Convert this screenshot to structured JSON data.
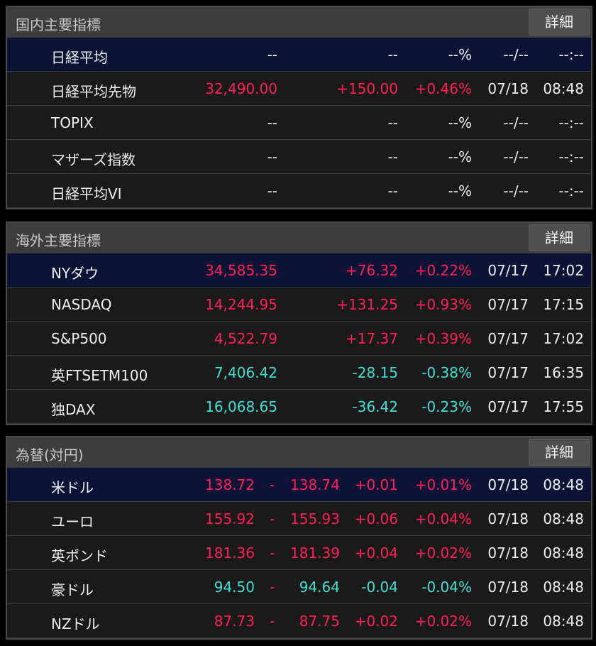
{
  "domestic": {
    "title": "国内主要指標",
    "detail_label": "詳細",
    "rows": [
      {
        "name": "日経平均",
        "price": "--",
        "change": "--",
        "pct": "--%",
        "date": "--/--",
        "time": "--:--",
        "dir": "neutral"
      },
      {
        "name": "日経平均先物",
        "price": "32,490.00",
        "change": "+150.00",
        "pct": "+0.46%",
        "date": "07/18",
        "time": "08:48",
        "dir": "up"
      },
      {
        "name": "TOPIX",
        "price": "--",
        "change": "--",
        "pct": "--%",
        "date": "--/--",
        "time": "--:--",
        "dir": "neutral"
      },
      {
        "name": "マザーズ指数",
        "price": "--",
        "change": "--",
        "pct": "--%",
        "date": "--/--",
        "time": "--:--",
        "dir": "neutral"
      },
      {
        "name": "日経平均VI",
        "price": "--",
        "change": "--",
        "pct": "--%",
        "date": "--/--",
        "time": "--:--",
        "dir": "neutral"
      }
    ]
  },
  "overseas": {
    "title": "海外主要指標",
    "detail_label": "詳細",
    "rows": [
      {
        "name": "NYダウ",
        "price": "34,585.35",
        "change": "+76.32",
        "pct": "+0.22%",
        "date": "07/17",
        "time": "17:02",
        "dir": "up"
      },
      {
        "name": "NASDAQ",
        "price": "14,244.95",
        "change": "+131.25",
        "pct": "+0.93%",
        "date": "07/17",
        "time": "17:15",
        "dir": "up"
      },
      {
        "name": "S&P500",
        "price": "4,522.79",
        "change": "+17.37",
        "pct": "+0.39%",
        "date": "07/17",
        "time": "17:02",
        "dir": "up"
      },
      {
        "name": "英FTSETM100",
        "price": "7,406.42",
        "change": "-28.15",
        "pct": "-0.38%",
        "date": "07/17",
        "time": "16:35",
        "dir": "down"
      },
      {
        "name": "独DAX",
        "price": "16,068.65",
        "change": "-36.42",
        "pct": "-0.23%",
        "date": "07/17",
        "time": "17:55",
        "dir": "down"
      }
    ]
  },
  "fx": {
    "title": "為替(対円)",
    "detail_label": "詳細",
    "rows": [
      {
        "name": "米ドル",
        "bid": "138.72",
        "dash": "-",
        "ask": "138.74",
        "change": "+0.01",
        "pct": "+0.01%",
        "date": "07/18",
        "time": "08:48",
        "dir": "up"
      },
      {
        "name": "ユーロ",
        "bid": "155.92",
        "dash": "-",
        "ask": "155.93",
        "change": "+0.06",
        "pct": "+0.04%",
        "date": "07/18",
        "time": "08:48",
        "dir": "up"
      },
      {
        "name": "英ポンド",
        "bid": "181.36",
        "dash": "-",
        "ask": "181.39",
        "change": "+0.04",
        "pct": "+0.02%",
        "date": "07/18",
        "time": "08:48",
        "dir": "up"
      },
      {
        "name": "豪ドル",
        "bid": "94.50",
        "dash": "-",
        "ask": "94.64",
        "change": "-0.04",
        "pct": "-0.04%",
        "date": "07/18",
        "time": "08:48",
        "dir": "down"
      },
      {
        "name": "NZドル",
        "bid": "87.73",
        "dash": "-",
        "ask": "87.75",
        "change": "+0.02",
        "pct": "+0.02%",
        "date": "07/18",
        "time": "08:48",
        "dir": "up"
      }
    ]
  },
  "colors": {
    "up": "#ff1f57",
    "down": "#3fe0d0",
    "highlight_row": "#0d1335",
    "header_bg": "#3d3d3d"
  }
}
